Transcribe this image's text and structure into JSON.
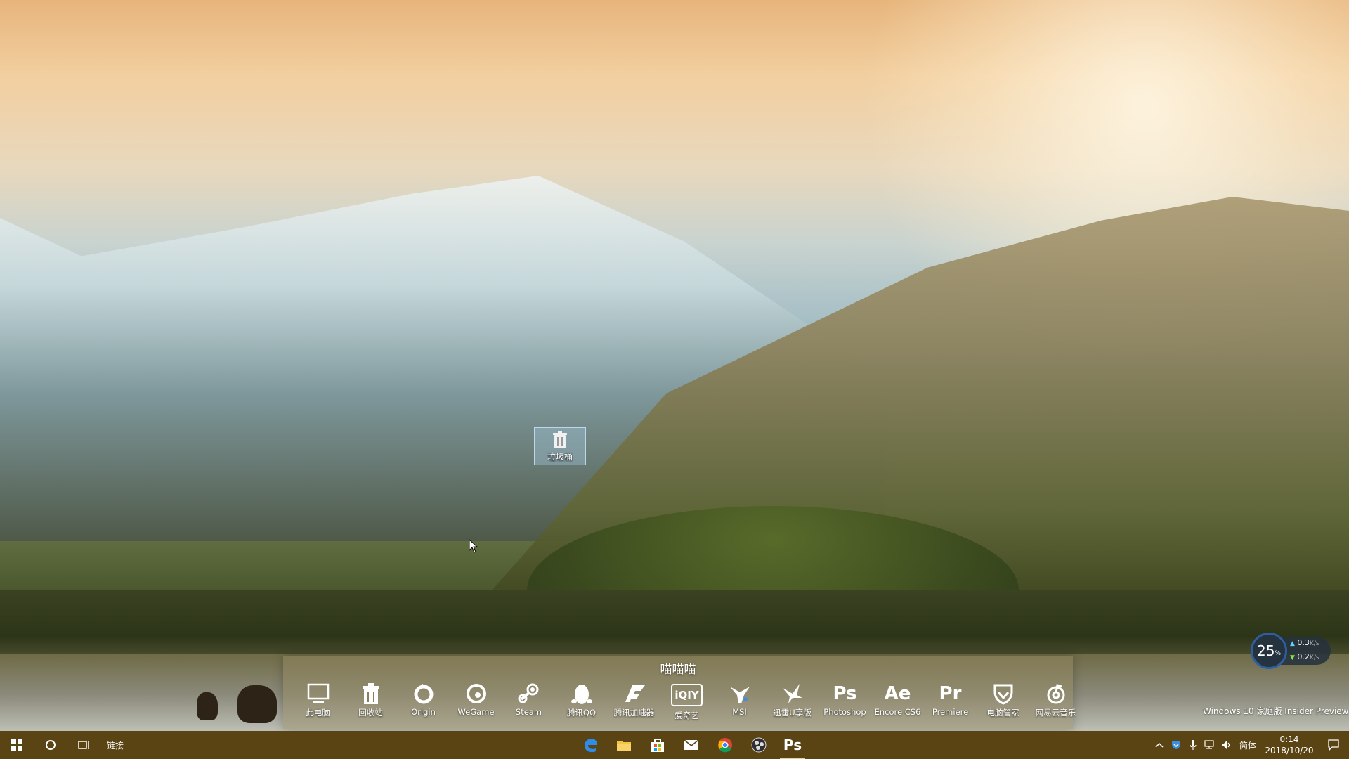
{
  "desktop": {
    "recycle_label": "垃圾桶",
    "watermark": "Windows 10 家庭版 Insider Preview"
  },
  "dock": {
    "title": "喵喵喵",
    "items": [
      {
        "label": "此电脑",
        "icon": "monitor-icon"
      },
      {
        "label": "回收站",
        "icon": "trash-icon"
      },
      {
        "label": "Origin",
        "icon": "origin-icon"
      },
      {
        "label": "WeGame",
        "icon": "wegame-icon"
      },
      {
        "label": "Steam",
        "icon": "steam-icon"
      },
      {
        "label": "腾讯QQ",
        "icon": "qq-penguin-icon"
      },
      {
        "label": "腾讯加速器",
        "icon": "accelerator-icon"
      },
      {
        "label": "爱奇艺",
        "icon": "iqiyi-icon",
        "icon_text": "iQIY"
      },
      {
        "label": "MSI",
        "icon": "msi-dragon-icon"
      },
      {
        "label": "迅雷U享版",
        "icon": "thunder-bird-icon"
      },
      {
        "label": "Photoshop",
        "icon": "photoshop-icon",
        "icon_text": "Ps"
      },
      {
        "label": "Encore CS6",
        "icon": "after-effects-icon",
        "icon_text": "Ae"
      },
      {
        "label": "Premiere",
        "icon": "premiere-icon",
        "icon_text": "Pr"
      },
      {
        "label": "电脑管家",
        "icon": "shield-icon"
      },
      {
        "label": "网易云音乐",
        "icon": "netease-music-icon"
      }
    ]
  },
  "netmon": {
    "percent": "25",
    "percent_unit": "%",
    "upload": "0.3",
    "download": "0.2",
    "rate_unit": "K/s"
  },
  "taskbar": {
    "links_label": "链接",
    "ps_text": "Ps",
    "ime_label": "简体",
    "time": "0:14",
    "date": "2018/10/20"
  },
  "colors": {
    "taskbar_bg": "#5a4413",
    "accent": "#e6cf9a"
  }
}
